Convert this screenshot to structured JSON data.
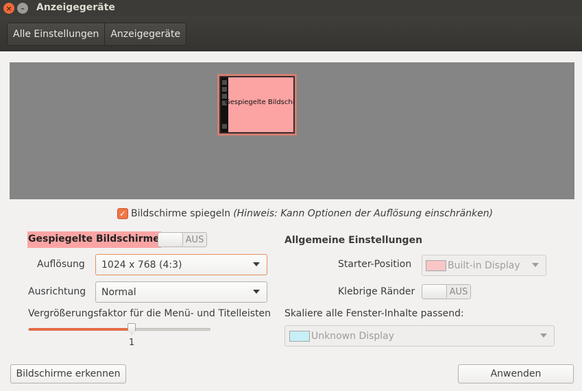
{
  "window": {
    "title": "Anzeigegeräte",
    "close_glyph": "×",
    "minimize_glyph": "–"
  },
  "breadcrumbs": [
    "Alle Einstellungen",
    "Anzeigegeräte"
  ],
  "preview": {
    "monitor_label": "Gespiegelte Bildschirme",
    "monitor_color": "#fca4a4"
  },
  "mirror": {
    "checked": true,
    "label": "Bildschirme spiegeln",
    "hint": "(Hinweis: Kann Optionen der Auflösung einschränken)"
  },
  "monitor_settings": {
    "heading": "Gespiegelte Bildschirme",
    "switch_state": "AUS",
    "resolution_label": "Auflösung",
    "resolution_value": "1024 x 768 (4:3)",
    "rotation_label": "Ausrichtung",
    "rotation_value": "Normal",
    "scale_label": "Vergrößerungsfaktor für die Menü- und Titelleisten",
    "scale_value": "1",
    "scale_fraction": 0.57
  },
  "general_settings": {
    "heading": "Allgemeine Einstellungen",
    "launcher_label": "Starter-Position",
    "launcher_value": "Built-in Display",
    "launcher_swatch": "#f9c6c6",
    "sticky_label": "Klebrige Ränder",
    "sticky_state": "AUS",
    "scale_all_label": "Skaliere alle Fenster-Inhalte passend:",
    "scale_all_value": "Unknown Display",
    "scale_all_swatch": "#c8eef6"
  },
  "buttons": {
    "detect": "Bildschirme erkennen",
    "apply": "Anwenden"
  },
  "accent_color": "#f07746"
}
